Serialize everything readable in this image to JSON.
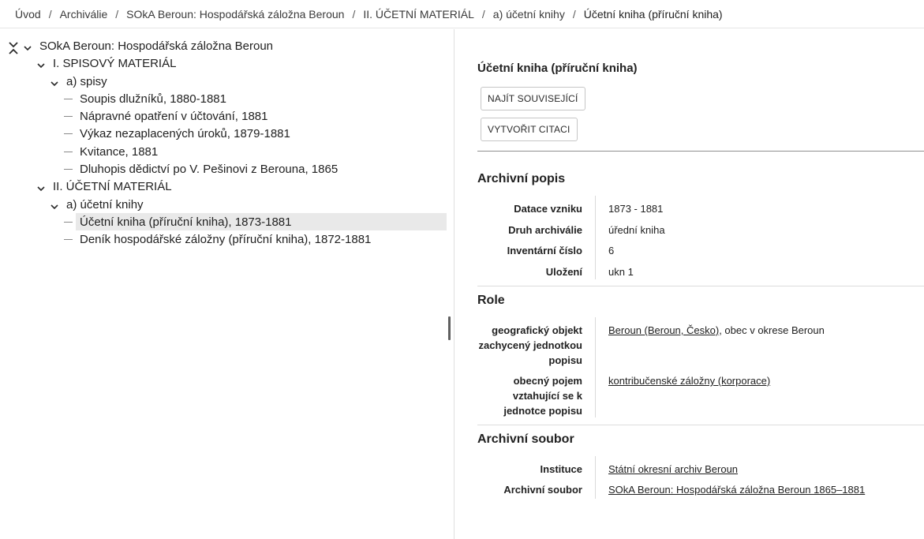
{
  "breadcrumb": {
    "items": [
      "Úvod",
      "Archiválie",
      "SOkA Beroun: Hospodářská záložna Beroun",
      "II. ÚČETNÍ MATERIÁL",
      "a) účetní knihy"
    ],
    "current": "Účetní kniha (příruční kniha)",
    "separator": "/"
  },
  "tree": {
    "root": "SOkA Beroun: Hospodářská záložna Beroun",
    "sections": [
      {
        "label": "I. SPISOVÝ MATERIÁL",
        "sub": "a) spisy",
        "items": [
          "Soupis dlužníků, 1880-1881",
          "Nápravné opatření v účtování, 1881",
          "Výkaz nezaplacených úroků, 1879-1881",
          "Kvitance, 1881",
          "Dluhopis dědictví po V. Pešinovi z Berouna, 1865"
        ]
      },
      {
        "label": "II. ÚČETNÍ MATERIÁL",
        "sub": "a) účetní knihy",
        "items": [
          "Účetní kniha (příruční kniha), 1873-1881",
          "Deník hospodářské záložny (příruční kniha), 1872-1881"
        ]
      }
    ]
  },
  "detail": {
    "title": "Účetní kniha (příruční kniha)",
    "buttons": {
      "find_related": "NAJÍT SOUVISEJÍCÍ",
      "create_citation": "VYTVOŘIT CITACI"
    },
    "archivni_popis": {
      "heading": "Archivní popis",
      "fields": [
        {
          "label": "Datace vzniku",
          "value": "1873 - 1881"
        },
        {
          "label": "Druh archiválie",
          "value": "úřední kniha"
        },
        {
          "label": "Inventární číslo",
          "value": "6"
        },
        {
          "label": "Uložení",
          "value": "ukn 1"
        }
      ]
    },
    "role": {
      "heading": "Role",
      "geo": {
        "label_lines": [
          "geografický objekt",
          "zachycený jednotkou",
          "popisu"
        ],
        "link": "Beroun (Beroun, Česko)",
        "suffix": ", obec v okrese Beroun"
      },
      "pojem": {
        "label_lines": [
          "obecný pojem",
          "vztahující se k",
          "jednotce popisu"
        ],
        "link": "kontribučenské záložny (korporace)"
      }
    },
    "archivni_soubor": {
      "heading": "Archivní soubor",
      "instituce_label": "Instituce",
      "instituce_value": "Státní okresní archiv Beroun",
      "soubor_label": "Archivní soubor",
      "soubor_value": "SOkA Beroun: Hospodářská záložna Beroun 1865–1881"
    }
  },
  "icons": {
    "collapse_all": "collapse-all-icon",
    "chevron": "chevron-down-icon"
  }
}
